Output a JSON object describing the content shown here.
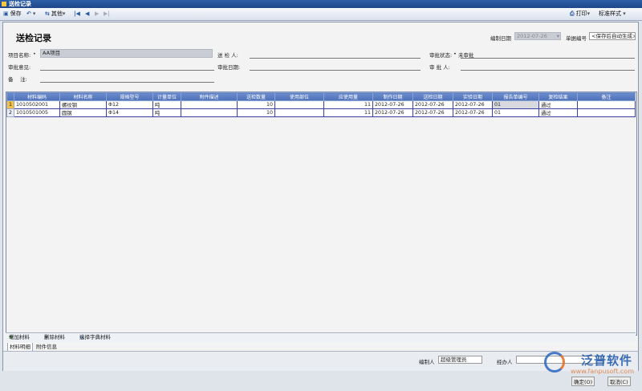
{
  "window": {
    "title": "送检记录"
  },
  "toolbar": {
    "save_label": "保存",
    "other_label": "其他",
    "print_label": "打印",
    "style_label": "标准样式"
  },
  "header": {
    "page_title": "送检记录",
    "date_label": "编制日期",
    "date_value": "2012-07-26",
    "docno_label": "单据编号",
    "docno_value": "<保存后自动生成>"
  },
  "form": {
    "project_label": "项目名称:",
    "project_value": "AA项目",
    "sender_label": "送 检 人:",
    "status_label": "审批状态:",
    "status_value": "未审批",
    "opinion_label": "审批意见:",
    "approve_date_label": "审批日期:",
    "approver_label": "审 批 人:",
    "remark_label": "备　 注:"
  },
  "table": {
    "columns": [
      "材料编码",
      "材料名称",
      "规格型号",
      "计量单位",
      "附件描述",
      "送检数量",
      "使用部位",
      "应使用量",
      "制作日期",
      "送检日期",
      "实验日期",
      "报告单编号",
      "复检结果",
      "备注"
    ],
    "rows": [
      {
        "num": "1",
        "cells": [
          "1010502001",
          "螺纹钢",
          "Φ12",
          "吨",
          "",
          "10",
          "",
          "11",
          "2012-07-26",
          "2012-07-26",
          "2012-07-26",
          "01",
          "通过",
          ""
        ]
      },
      {
        "num": "2",
        "cells": [
          "1010501005",
          "圆钢",
          "Φ14",
          "吨",
          "",
          "10",
          "",
          "11",
          "2012-07-26",
          "2012-07-26",
          "2012-07-26",
          "01",
          "通过",
          ""
        ]
      }
    ]
  },
  "bottom_toolbar": {
    "add_label": "增加材料",
    "delete_label": "删除材料",
    "dict_label": "选择字典材料"
  },
  "tabs": [
    "材料明细",
    "附件信息"
  ],
  "footer": {
    "maker_label": "编制人",
    "maker_value": "超级管理员",
    "handler_label": "经办人",
    "ok_label": "确定(O)",
    "cancel_label": "取消(C)"
  },
  "watermark": {
    "brand": "泛普软件",
    "url": "www.fanpusoft.com"
  }
}
